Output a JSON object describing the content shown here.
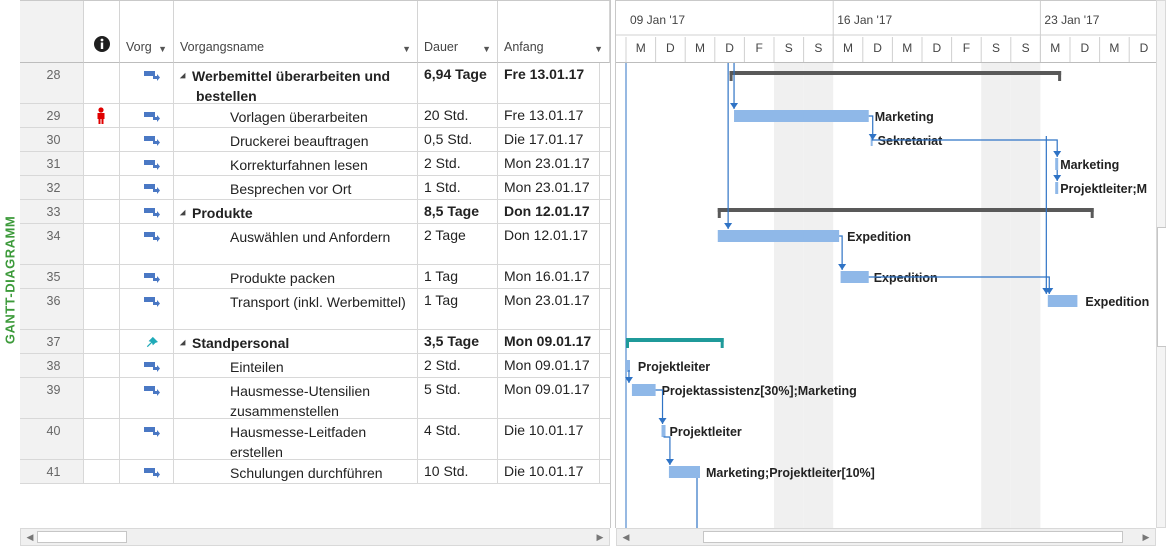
{
  "view_label": "GANTT-DIAGRAMM",
  "table": {
    "columns": {
      "info_icon": "info-icon",
      "mode": "Vorg",
      "name": "Vorgangsname",
      "duration": "Dauer",
      "start": "Anfang"
    },
    "rows": [
      {
        "id": "28",
        "indicator": "",
        "name": "Werbemittel überarbeiten und bestellen",
        "summary": true,
        "duration": "6,94 Tage",
        "start": "Fre 13.01.17",
        "lines": 2
      },
      {
        "id": "29",
        "indicator": "person-icon",
        "name": "Vorlagen überarbeiten",
        "summary": false,
        "duration": "20 Std.",
        "start": "Fre 13.01.17",
        "lines": 1
      },
      {
        "id": "30",
        "indicator": "",
        "name": "Druckerei beauftragen",
        "summary": false,
        "duration": "0,5 Std.",
        "start": "Die 17.01.17",
        "lines": 1
      },
      {
        "id": "31",
        "indicator": "",
        "name": "Korrekturfahnen lesen",
        "summary": false,
        "duration": "2 Std.",
        "start": "Mon 23.01.17",
        "lines": 1
      },
      {
        "id": "32",
        "indicator": "",
        "name": "Besprechen vor Ort",
        "summary": false,
        "duration": "1 Std.",
        "start": "Mon 23.01.17",
        "lines": 1
      },
      {
        "id": "33",
        "indicator": "",
        "name": "Produkte",
        "summary": true,
        "duration": "8,5 Tage",
        "start": "Don 12.01.17",
        "lines": 1
      },
      {
        "id": "34",
        "indicator": "",
        "name": "Auswählen und Anfordern",
        "summary": false,
        "duration": "2 Tage",
        "start": "Don 12.01.17",
        "lines": 2
      },
      {
        "id": "35",
        "indicator": "",
        "name": "Produkte packen",
        "summary": false,
        "duration": "1 Tag",
        "start": "Mon 16.01.17",
        "lines": 1
      },
      {
        "id": "36",
        "indicator": "",
        "name": "Transport (inkl. Werbemittel)",
        "summary": false,
        "duration": "1 Tag",
        "start": "Mon 23.01.17",
        "lines": 2
      },
      {
        "id": "37",
        "indicator": "",
        "name": "Standpersonal",
        "summary": true,
        "duration": "3,5 Tage",
        "start": "Mon 09.01.17",
        "lines": 1,
        "mode": "pin"
      },
      {
        "id": "38",
        "indicator": "",
        "name": "Einteilen",
        "summary": false,
        "duration": "2 Std.",
        "start": "Mon 09.01.17",
        "lines": 1
      },
      {
        "id": "39",
        "indicator": "",
        "name": "Hausmesse-Utensilien zusammenstellen",
        "summary": false,
        "duration": "5 Std.",
        "start": "Mon 09.01.17",
        "lines": 2
      },
      {
        "id": "40",
        "indicator": "",
        "name": "Hausmesse-Leitfaden erstellen",
        "summary": false,
        "duration": "4 Std.",
        "start": "Die 10.01.17",
        "lines": 2
      },
      {
        "id": "41",
        "indicator": "",
        "name": "Schulungen durchführen",
        "summary": false,
        "duration": "10 Std.",
        "start": "Die 10.01.17",
        "lines": 1
      }
    ]
  },
  "timeline": {
    "weeks": [
      "09 Jan '17",
      "16 Jan '17",
      "23 Jan '17"
    ],
    "days": [
      "M",
      "D",
      "M",
      "D",
      "F",
      "S",
      "S",
      "M",
      "D",
      "M",
      "D",
      "F",
      "S",
      "S",
      "M",
      "D",
      "M",
      "D"
    ]
  },
  "gantt": {
    "labels": {
      "29": "Marketing",
      "30": "Sekretariat",
      "31": "Marketing",
      "32": "Projektleiter;M",
      "34": "Expedition",
      "35": "Expedition",
      "36": "Expedition",
      "38": "Projektleiter",
      "39": "Projektassistenz[30%];Marketing",
      "40": "Projektleiter",
      "41": "Marketing;Projektleiter[10%]"
    }
  },
  "colors": {
    "task_bar": "#8fb8e8",
    "summary_bar": "#595959",
    "manual_summary": "#1f9a9a",
    "link": "#2f73c5",
    "weekend_shade": "#f0f0f0",
    "view_label": "#3c9a3a"
  }
}
